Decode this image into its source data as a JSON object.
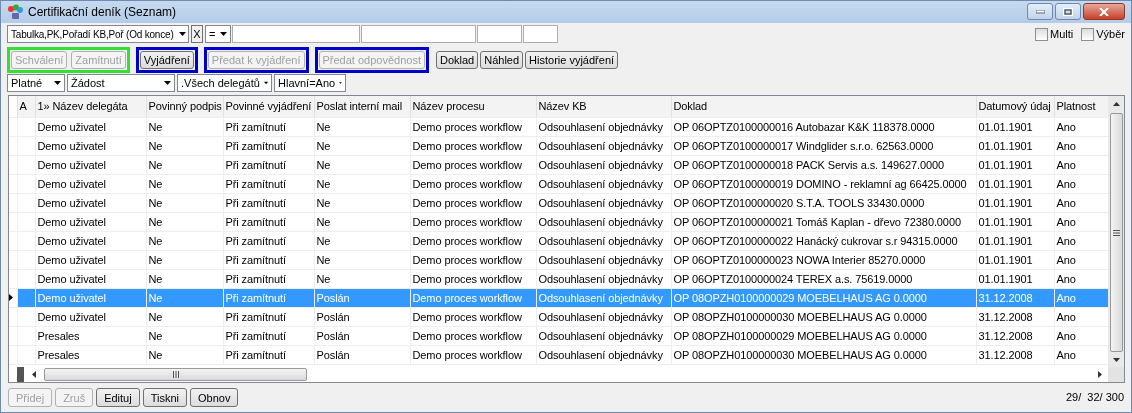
{
  "window": {
    "title": "Certifikační deník (Seznam)"
  },
  "filter_bar": {
    "sort": "Tabulka,PK,Pořadí KB,Poř (Od konce)",
    "clear": "X",
    "operator": "="
  },
  "options": [
    {
      "label": "Multi",
      "checked": false
    },
    {
      "label": "Výběr",
      "checked": false
    }
  ],
  "action_groups": [
    {
      "color": "#33e033",
      "buttons": [
        {
          "label": "Schválení",
          "disabled": true
        },
        {
          "label": "Zamítnutí",
          "disabled": true
        }
      ]
    },
    {
      "color": "#0000cc",
      "buttons": [
        {
          "label": "Vyjádření",
          "disabled": false
        }
      ]
    },
    {
      "color": "#0000cc",
      "buttons": [
        {
          "label": "Předat k vyjádření",
          "disabled": true
        }
      ]
    },
    {
      "color": "#0000cc",
      "buttons": [
        {
          "label": "Předat odpovědnost",
          "disabled": true
        }
      ]
    },
    {
      "buttons": [
        {
          "label": "Doklad",
          "disabled": false
        },
        {
          "label": "Náhled",
          "disabled": false
        },
        {
          "label": "Historie vyjádření",
          "disabled": false
        }
      ]
    }
  ],
  "filters": [
    "Platné",
    "Žádost",
    ".Všech delegátů",
    "Hlavní=Ano"
  ],
  "table": {
    "marker_column": "A",
    "columns": [
      "1» Název delegáta",
      "Povinný podpis",
      "Povinné vyjádření",
      "Poslat interní mail",
      "Název procesu",
      "Název KB",
      "Doklad",
      "Datumový údaj",
      "Platnost"
    ],
    "rows": [
      {
        "selected": false,
        "cells": [
          "Demo uživatel",
          "Ne",
          "Při zamítnutí",
          "Ne",
          "Demo proces workflow",
          "Odsouhlasení objednávky",
          "OP 06OPTZ0100000016 Autobazar K&K 118378.0000",
          "01.01.1901",
          "Ano"
        ]
      },
      {
        "selected": false,
        "cells": [
          "Demo uživatel",
          "Ne",
          "Při zamítnutí",
          "Ne",
          "Demo proces workflow",
          "Odsouhlasení objednávky",
          "OP 06OPTZ0100000017 Windglider s.r.o. 62563.0000",
          "01.01.1901",
          "Ano"
        ]
      },
      {
        "selected": false,
        "cells": [
          "Demo uživatel",
          "Ne",
          "Při zamítnutí",
          "Ne",
          "Demo proces workflow",
          "Odsouhlasení objednávky",
          "OP 06OPTZ0100000018 PACK Servis a.s. 149627.0000",
          "01.01.1901",
          "Ano"
        ]
      },
      {
        "selected": false,
        "cells": [
          "Demo uživatel",
          "Ne",
          "Při zamítnutí",
          "Ne",
          "Demo proces workflow",
          "Odsouhlasení objednávky",
          "OP 06OPTZ0100000019 DOMINO - reklamní ag 66425.0000",
          "01.01.1901",
          "Ano"
        ]
      },
      {
        "selected": false,
        "cells": [
          "Demo uživatel",
          "Ne",
          "Při zamítnutí",
          "Ne",
          "Demo proces workflow",
          "Odsouhlasení objednávky",
          "OP 06OPTZ0100000020 S.T.A. TOOLS 33430.0000",
          "01.01.1901",
          "Ano"
        ]
      },
      {
        "selected": false,
        "cells": [
          "Demo uživatel",
          "Ne",
          "Při zamítnutí",
          "Ne",
          "Demo proces workflow",
          "Odsouhlasení objednávky",
          "OP 06OPTZ0100000021 Tomáš Kaplan - dřevo 72380.0000",
          "01.01.1901",
          "Ano"
        ]
      },
      {
        "selected": false,
        "cells": [
          "Demo uživatel",
          "Ne",
          "Při zamítnutí",
          "Ne",
          "Demo proces workflow",
          "Odsouhlasení objednávky",
          "OP 06OPTZ0100000022 Hanácký cukrovar s.r 94315.0000",
          "01.01.1901",
          "Ano"
        ]
      },
      {
        "selected": false,
        "cells": [
          "Demo uživatel",
          "Ne",
          "Při zamítnutí",
          "Ne",
          "Demo proces workflow",
          "Odsouhlasení objednávky",
          "OP 06OPTZ0100000023 NOWA Interier 85270.0000",
          "01.01.1901",
          "Ano"
        ]
      },
      {
        "selected": false,
        "cells": [
          "Demo uživatel",
          "Ne",
          "Při zamítnutí",
          "Ne",
          "Demo proces workflow",
          "Odsouhlasení objednávky",
          "OP 06OPTZ0100000024 TEREX a.s. 75619.0000",
          "01.01.1901",
          "Ano"
        ]
      },
      {
        "selected": true,
        "cells": [
          "Demo uživatel",
          "Ne",
          "Při zamítnutí",
          "Poslán",
          "Demo proces workflow",
          "Odsouhlasení objednávky",
          "OP 08OPZH0100000029 MOEBELHAUS AG 0.0000",
          "31.12.2008",
          "Ano"
        ]
      },
      {
        "selected": false,
        "cells": [
          "Demo uživatel",
          "Ne",
          "Při zamítnutí",
          "Poslán",
          "Demo proces workflow",
          "Odsouhlasení objednávky",
          "OP 08OPZH0100000030 MOEBELHAUS AG 0.0000",
          "31.12.2008",
          "Ano"
        ]
      },
      {
        "selected": false,
        "cells": [
          "Presales",
          "Ne",
          "Při zamítnutí",
          "Poslán",
          "Demo proces workflow",
          "Odsouhlasení objednávky",
          "OP 08OPZH0100000029 MOEBELHAUS AG 0.0000",
          "31.12.2008",
          "Ano"
        ]
      },
      {
        "selected": false,
        "cells": [
          "Presales",
          "Ne",
          "Při zamítnutí",
          "Poslán",
          "Demo proces workflow",
          "Odsouhlasení objednávky",
          "OP 08OPZH0100000030 MOEBELHAUS AG 0.0000",
          "31.12.2008",
          "Ano"
        ]
      }
    ]
  },
  "footer_buttons": [
    {
      "label": "Přidej",
      "disabled": true
    },
    {
      "label": "Zruš",
      "disabled": true
    },
    {
      "label": "Edituj",
      "disabled": false
    },
    {
      "label": "Tiskni",
      "disabled": false
    },
    {
      "label": "Obnov",
      "disabled": false
    }
  ],
  "status": "29/  32/ 300"
}
